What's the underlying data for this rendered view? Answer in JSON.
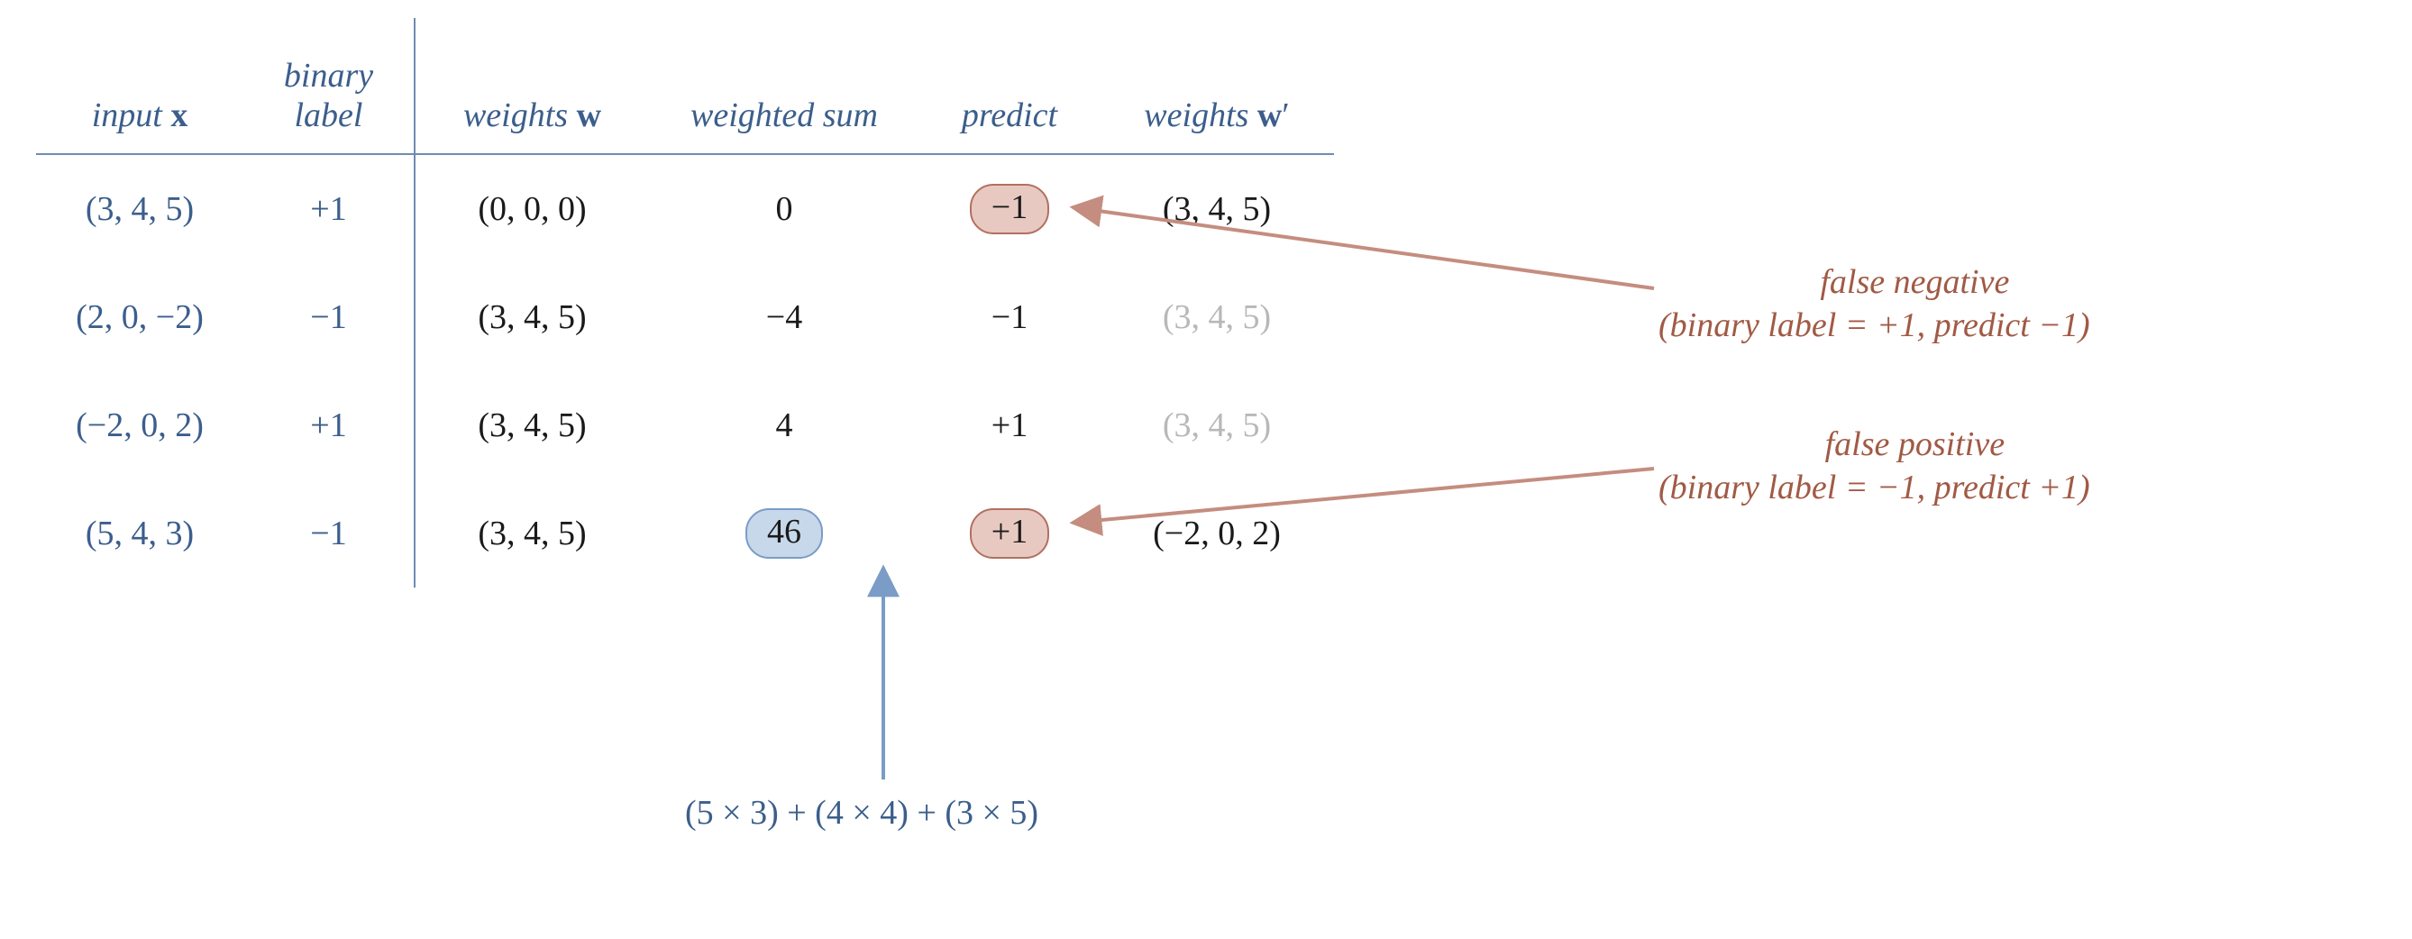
{
  "headers": {
    "input": "input ",
    "input_sym": "x",
    "binary_l1": "binary",
    "binary_l2": "label",
    "weights": "weights ",
    "weights_sym": "w",
    "wsum": "weighted sum",
    "predict": "predict",
    "weights2": "weights ",
    "weights2_sym": "w",
    "weights2_prime": "′"
  },
  "rows": [
    {
      "input": "(3, 4, 5)",
      "label": "+1",
      "w": "(0, 0, 0)",
      "wsum": "0",
      "predict": "−1",
      "predict_pill": "red",
      "wprime": "(3, 4, 5)",
      "wprime_faded": false
    },
    {
      "input": "(2, 0, −2)",
      "label": "−1",
      "w": "(3, 4, 5)",
      "wsum": "−4",
      "predict": "−1",
      "predict_pill": "none",
      "wprime": "(3, 4, 5)",
      "wprime_faded": true
    },
    {
      "input": "(−2, 0, 2)",
      "label": "+1",
      "w": "(3, 4, 5)",
      "wsum": "4",
      "predict": "+1",
      "predict_pill": "none",
      "wprime": "(3, 4, 5)",
      "wprime_faded": true
    },
    {
      "input": "(5, 4, 3)",
      "label": "−1",
      "w": "(3, 4, 5)",
      "wsum": "46",
      "wsum_pill": "blue",
      "predict": "+1",
      "predict_pill": "red",
      "wprime": "(−2, 0, 2)",
      "wprime_faded": false
    }
  ],
  "annotations": {
    "fn_l1": "false negative",
    "fn_l2": "(binary label = +1, predict −1)",
    "fp_l1": "false positive",
    "fp_l2": "(binary label = −1, predict +1)"
  },
  "caption": "(5 × 3) + (4 × 4) + (3 × 5)",
  "colors": {
    "blue": "#3b5e8c",
    "red_text": "#a15a45",
    "pill_red_bg": "#e8c9c2",
    "pill_red_border": "#b27060",
    "pill_blue_bg": "#c7d8ea",
    "pill_blue_border": "#7a9cc6",
    "rule": "#6e8bb3",
    "faded": "#b8b8b8"
  },
  "chart_data": {
    "type": "table",
    "columns": [
      "input x",
      "binary label",
      "weights w",
      "weighted sum",
      "predict",
      "weights w'"
    ],
    "rows": [
      [
        "(3,4,5)",
        "+1",
        "(0,0,0)",
        0,
        "-1",
        "(3,4,5)"
      ],
      [
        "(2,0,-2)",
        "-1",
        "(3,4,5)",
        -4,
        "-1",
        "(3,4,5)"
      ],
      [
        "(-2,0,2)",
        "+1",
        "(3,4,5)",
        4,
        "+1",
        "(3,4,5)"
      ],
      [
        "(5,4,3)",
        "-1",
        "(3,4,5)",
        46,
        "+1",
        "(-2,0,2)"
      ]
    ],
    "highlights": {
      "predict_errors_rows": [
        0,
        3
      ],
      "weighted_sum_callout_row": 3,
      "weighted_sum_formula": "(5×3)+(4×4)+(3×5)"
    },
    "annotations": [
      {
        "target_row": 0,
        "text": "false negative (binary label = +1, predict -1)"
      },
      {
        "target_row": 3,
        "text": "false positive (binary label = -1, predict +1)"
      }
    ]
  }
}
